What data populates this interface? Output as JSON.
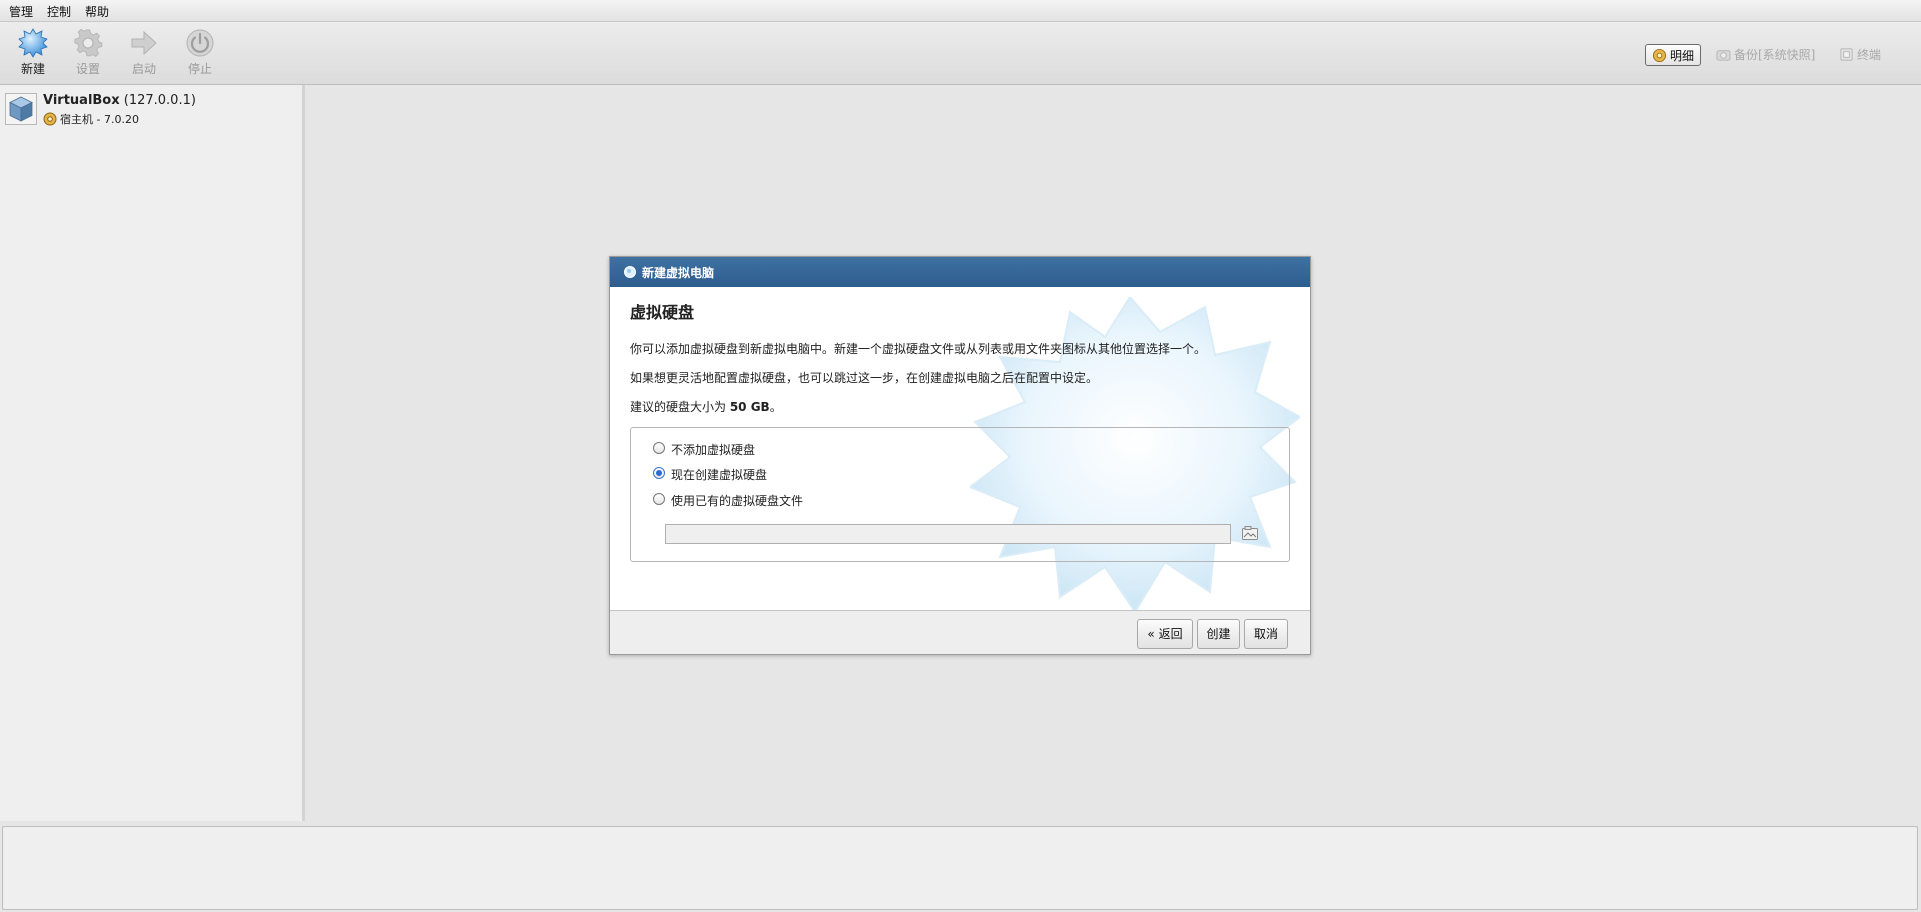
{
  "menubar": {
    "items": [
      "管理",
      "控制",
      "帮助"
    ]
  },
  "toolbar": {
    "buttons": [
      {
        "label": "新建",
        "icon": "new-vm-icon",
        "enabled": true
      },
      {
        "label": "设置",
        "icon": "gear-icon",
        "enabled": false
      },
      {
        "label": "启动",
        "icon": "start-arrow-icon",
        "enabled": false
      },
      {
        "label": "停止",
        "icon": "power-icon",
        "enabled": false
      }
    ],
    "views": [
      {
        "label": "明细",
        "icon": "details-icon",
        "active": true
      },
      {
        "label": "备份[系统快照]",
        "icon": "snapshot-camera-icon",
        "active": false
      },
      {
        "label": "终端",
        "icon": "terminal-icon",
        "active": false
      }
    ]
  },
  "vm_list": {
    "items": [
      {
        "name": "VirtualBox",
        "address": "(127.0.0.1)",
        "subtitle": "宿主机 - 7.0.20",
        "icon": "virtualbox-icon",
        "sub_icon": "host-gear-icon"
      }
    ]
  },
  "dialog": {
    "title": "新建虚拟电脑",
    "heading": "虚拟硬盘",
    "paragraph1": "你可以添加虚拟硬盘到新虚拟电脑中。新建一个虚拟硬盘文件或从列表或用文件夹图标从其他位置选择一个。",
    "paragraph2": "如果想更灵活地配置虚拟硬盘，也可以跳过这一步，在创建虚拟电脑之后在配置中设定。",
    "size_prefix": "建议的硬盘大小为 ",
    "size_value": "50 GB",
    "size_suffix": "。",
    "options": [
      {
        "label": "不添加虚拟硬盘",
        "checked": false
      },
      {
        "label": "现在创建虚拟硬盘",
        "checked": true
      },
      {
        "label": "使用已有的虚拟硬盘文件",
        "checked": false
      }
    ],
    "file_value": "",
    "buttons": {
      "back": "« 返回",
      "create": "创建",
      "cancel": "取消"
    }
  },
  "colors": {
    "title_bar": "#3569a0",
    "radio_accent": "#2b6bd6",
    "star": "#cfe7f7"
  }
}
